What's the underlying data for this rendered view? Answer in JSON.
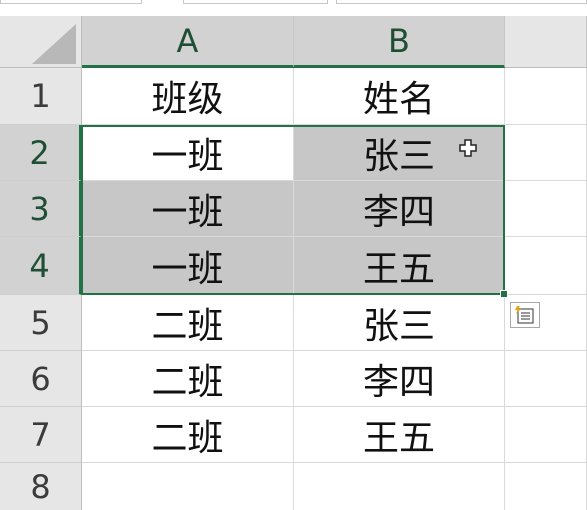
{
  "columns": [
    "A",
    "B"
  ],
  "rows": [
    "1",
    "2",
    "3",
    "4",
    "5",
    "6",
    "7",
    "8"
  ],
  "cells": [
    [
      "班级",
      "姓名"
    ],
    [
      "一班",
      "张三"
    ],
    [
      "一班",
      "李四"
    ],
    [
      "一班",
      "王五"
    ],
    [
      "二班",
      "张三"
    ],
    [
      "二班",
      "李四"
    ],
    [
      "二班",
      "王五"
    ],
    [
      "",
      ""
    ]
  ],
  "icons": {
    "cursor": "plus-cursor-icon",
    "quick_analysis": "quick-analysis-icon"
  },
  "colors": {
    "selection_border": "#217346",
    "selection_fill": "#c7c7c7",
    "header_bg": "#e6e6e6"
  }
}
